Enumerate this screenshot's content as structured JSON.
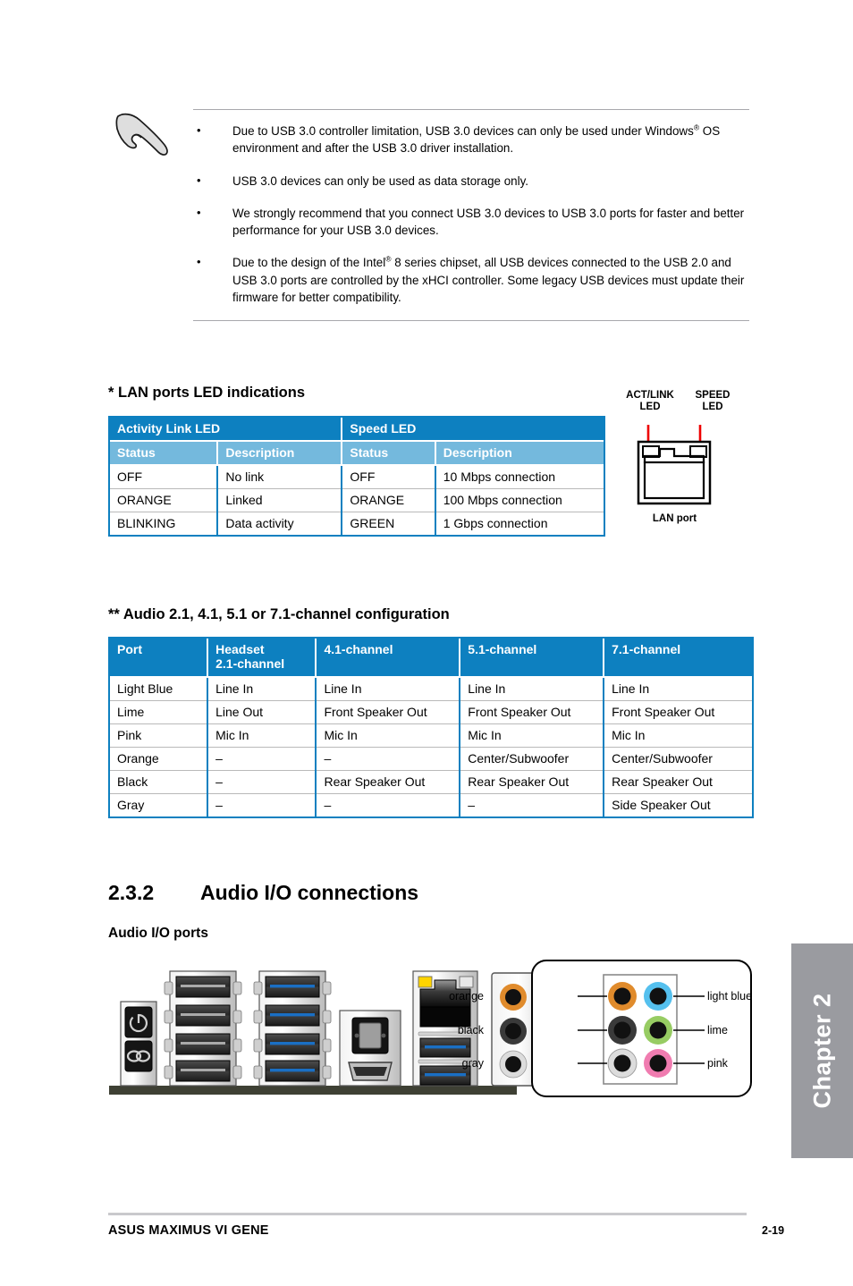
{
  "note": {
    "icon": "note-hand-icon",
    "items": [
      {
        "pre": "Due to USB 3.0 controller limitation, USB 3.0 devices can only be used under Windows",
        "sup": "®",
        "post": " OS environment and after the USB 3.0 driver installation."
      },
      {
        "pre": "USB 3.0 devices can only be used as data storage only.",
        "sup": "",
        "post": ""
      },
      {
        "pre": "We strongly recommend that you connect USB 3.0 devices to USB 3.0 ports for faster and better performance for your USB 3.0 devices.",
        "sup": "",
        "post": ""
      },
      {
        "pre": "Due to the design of the Intel",
        "sup": "®",
        "post": " 8 series chipset, all USB devices connected to the USB 2.0 and USB 3.0 ports are controlled by the xHCI controller. Some legacy USB devices must update their firmware for better compatibility."
      }
    ],
    "bullet": "•"
  },
  "lan_section": {
    "title": "* LAN ports LED indications",
    "group_headers": [
      "Activity Link LED",
      "Speed LED"
    ],
    "sub_headers": [
      "Status",
      "Description",
      "Status",
      "Description"
    ],
    "rows": [
      [
        "OFF",
        "No link",
        "OFF",
        "10 Mbps connection"
      ],
      [
        "ORANGE",
        "Linked",
        "ORANGE",
        "100 Mbps connection"
      ],
      [
        "BLINKING",
        "Data activity",
        "GREEN",
        "1 Gbps connection"
      ]
    ],
    "figure": {
      "act_link_label_line1": "ACT/LINK",
      "act_link_label_line2": "LED",
      "speed_label_line1": "SPEED",
      "speed_label_line2": "LED",
      "port_label": "LAN port",
      "pointer_color": "#ee0000"
    }
  },
  "audio_section": {
    "title": "** Audio 2.1, 4.1, 5.1 or 7.1-channel configuration",
    "headers": [
      "Port",
      "Headset\n2.1-channel",
      "4.1-channel",
      "5.1-channel",
      "7.1-channel"
    ],
    "header_port": "Port",
    "header_headset_l1": "Headset",
    "header_headset_l2": "2.1-channel",
    "header_41": "4.1-channel",
    "header_51": "5.1-channel",
    "header_71": "7.1-channel",
    "rows": [
      [
        "Light Blue",
        "Line In",
        "Line In",
        "Line In",
        "Line In"
      ],
      [
        "Lime",
        "Line Out",
        "Front Speaker Out",
        "Front Speaker Out",
        "Front Speaker Out"
      ],
      [
        "Pink",
        "Mic In",
        "Mic In",
        "Mic In",
        "Mic In"
      ],
      [
        "Orange",
        "–",
        "–",
        "Center/Subwoofer",
        "Center/Subwoofer"
      ],
      [
        "Black",
        "–",
        "Rear Speaker Out",
        "Rear Speaker Out",
        "Rear Speaker Out"
      ],
      [
        "Gray",
        "–",
        "–",
        "–",
        "Side Speaker Out"
      ]
    ]
  },
  "section": {
    "number": "2.3.2",
    "heading": "Audio I/O connections",
    "subheading": "Audio I/O ports"
  },
  "io_panel": {
    "callout": {
      "left_labels": [
        "orange",
        "black",
        "gray"
      ],
      "right_labels": [
        "light blue",
        "lime",
        "pink"
      ],
      "jack_colors": {
        "orange": "#e08b2c",
        "light_blue": "#55c0ee",
        "black": "#3a3a3a",
        "lime": "#97cc63",
        "gray": "#dcdcdc",
        "pink": "#f07cb0"
      }
    },
    "led_colors": {
      "lan_act_led": "#ffd400",
      "lan_speed_led": "#e4e4e4",
      "usb3_blue": "#1a6fc4"
    }
  },
  "chapter_tab": {
    "label": "Chapter 2",
    "background": "#9a9ba0"
  },
  "footer": {
    "left": "ASUS MAXIMUS VI GENE",
    "right": "2-19"
  },
  "colors": {
    "table_header_dark": "#0d80c0",
    "table_header_light": "#74b9dd",
    "rule_gray": "#a8a8ac"
  }
}
